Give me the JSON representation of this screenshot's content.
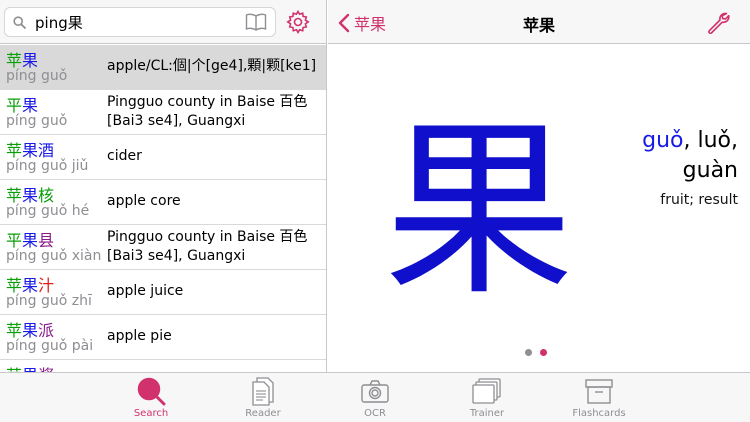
{
  "search": {
    "value": "ping果"
  },
  "results": [
    {
      "hanzi": [
        {
          "c": "苹",
          "t": "t1"
        },
        {
          "c": "果",
          "t": "t3"
        }
      ],
      "pinyin": "píng guǒ",
      "definition": "apple/CL:個|个[ge4],顆|颗[ke1]",
      "selected": true
    },
    {
      "hanzi": [
        {
          "c": "平",
          "t": "t1"
        },
        {
          "c": "果",
          "t": "t3"
        }
      ],
      "pinyin": "píng guǒ",
      "definition": "Pingguo county in Baise 百色[Bai3 se4], Guangxi",
      "selected": false
    },
    {
      "hanzi": [
        {
          "c": "苹",
          "t": "t1"
        },
        {
          "c": "果",
          "t": "t3"
        },
        {
          "c": "酒",
          "t": "t3"
        }
      ],
      "pinyin": "píng guǒ jiǔ",
      "definition": "cider",
      "selected": false
    },
    {
      "hanzi": [
        {
          "c": "苹",
          "t": "t1"
        },
        {
          "c": "果",
          "t": "t3"
        },
        {
          "c": "核",
          "t": "t1"
        }
      ],
      "pinyin": "píng guǒ hé",
      "definition": "apple core",
      "selected": false
    },
    {
      "hanzi": [
        {
          "c": "平",
          "t": "t1"
        },
        {
          "c": "果",
          "t": "t3"
        },
        {
          "c": "县",
          "t": "t4"
        }
      ],
      "pinyin": "píng guǒ xiàn",
      "definition": "Pingguo county in Baise 百色[Bai3 se4], Guangxi",
      "selected": false
    },
    {
      "hanzi": [
        {
          "c": "苹",
          "t": "t1"
        },
        {
          "c": "果",
          "t": "t3"
        },
        {
          "c": "汁",
          "t": "t2"
        }
      ],
      "pinyin": "píng guǒ zhī",
      "definition": "apple juice",
      "selected": false
    },
    {
      "hanzi": [
        {
          "c": "苹",
          "t": "t1"
        },
        {
          "c": "果",
          "t": "t3"
        },
        {
          "c": "派",
          "t": "t4"
        }
      ],
      "pinyin": "píng guǒ pài",
      "definition": "apple pie",
      "selected": false
    },
    {
      "hanzi": [
        {
          "c": "苹",
          "t": "t1"
        },
        {
          "c": "果",
          "t": "t3"
        },
        {
          "c": "酱",
          "t": "t4"
        }
      ],
      "pinyin": "",
      "definition": "",
      "selected": false
    }
  ],
  "detail": {
    "back_label": "苹果",
    "title": "苹果",
    "character": "果",
    "reading_main": "guǒ",
    "reading_rest": ", luǒ,",
    "reading_line2": "guàn",
    "gloss": "fruit; result"
  },
  "tabs": [
    {
      "label": "Search",
      "icon": "search-icon",
      "active": true
    },
    {
      "label": "Reader",
      "icon": "document-icon",
      "active": false
    },
    {
      "label": "OCR",
      "icon": "camera-icon",
      "active": false
    },
    {
      "label": "Trainer",
      "icon": "cards-icon",
      "active": false
    },
    {
      "label": "Flashcards",
      "icon": "box-icon",
      "active": false
    }
  ],
  "colors": {
    "accent": "#d1326e",
    "tone1": "#0a9e0a",
    "tone2": "#e01a1a",
    "tone3": "#1a1ae6",
    "tone4": "#8a1a8a"
  }
}
